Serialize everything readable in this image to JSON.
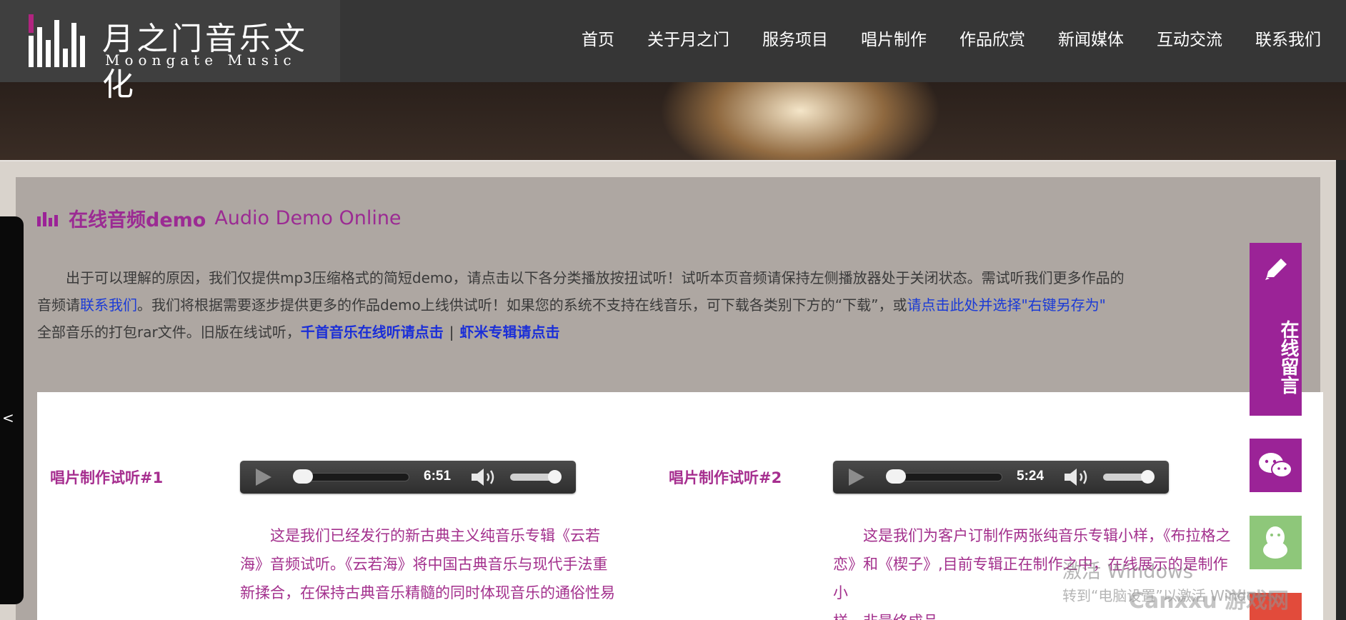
{
  "brand": {
    "name_cn": "月之门音乐文化",
    "name_en": "Moongate Music"
  },
  "nav": {
    "items": [
      "首页",
      "关于月之门",
      "服务项目",
      "唱片制作",
      "作品欣赏",
      "新闻媒体",
      "互动交流",
      "联系我们"
    ]
  },
  "section": {
    "title_cn": "在线音频demo",
    "title_en": "Audio Demo Online"
  },
  "intro": {
    "p1": "出于可以理解的原因，我们仅提供mp3压缩格式的简短demo，请点击以下各分类播放按扭试听！试听本页音频请保持左侧播放器处于关闭状态。需试听我们更多作品的",
    "p2_prefix": "音频请",
    "p2_link": "联系我们",
    "p2_mid": "。我们将根据需要逐步提供更多的作品demo上线供试听！如果您的系统不支持在线音乐，可下载各类别下方的“下载”，或",
    "p2_link2": "请点击此处并选择\"右键另存为\"",
    "p3_prefix": "全部音乐的打包rar文件。旧版在线试听，",
    "p3_link1": "千首音乐在线听请点击",
    "p3_sep": "|",
    "p3_link2": "虾米专辑请点击"
  },
  "demos": [
    {
      "label": "唱片制作试听#1",
      "time": "6:51",
      "desc_lines": [
        "这是我们已经发行的新古典主义纯音乐专辑《云若",
        "海》音频试听。《云若海》将中国古典音乐与现代手法重",
        "新揉合，在保持古典音乐精髓的同时体现音乐的通俗性易"
      ]
    },
    {
      "label": "唱片制作试听#2",
      "time": "5:24",
      "desc_lines": [
        "这是我们为客户订制作两张纯音乐专辑小样，《布拉格之",
        "恋》和《楔子》,目前专辑正在制作之中，在线展示的是制作小",
        "样，非最终成品。"
      ]
    }
  ],
  "left_tab": {
    "label": "<"
  },
  "float": {
    "message_label": "在线留言"
  },
  "watermark": {
    "line1": "激活 Windows",
    "line2": "转到“电脑设置”以激活 Windows。",
    "site": "Canxxu 游戏网"
  },
  "colors": {
    "accent": "#9b2397",
    "header_bg": "#363636",
    "link_blue": "#1a3ad6",
    "qq_green": "#8ec77a"
  },
  "icons": {
    "pencil": "pencil-icon",
    "wechat": "wechat-icon",
    "qq": "qq-icon",
    "play": "play-icon",
    "volume": "volume-icon",
    "bars": "audio-bars-icon"
  }
}
